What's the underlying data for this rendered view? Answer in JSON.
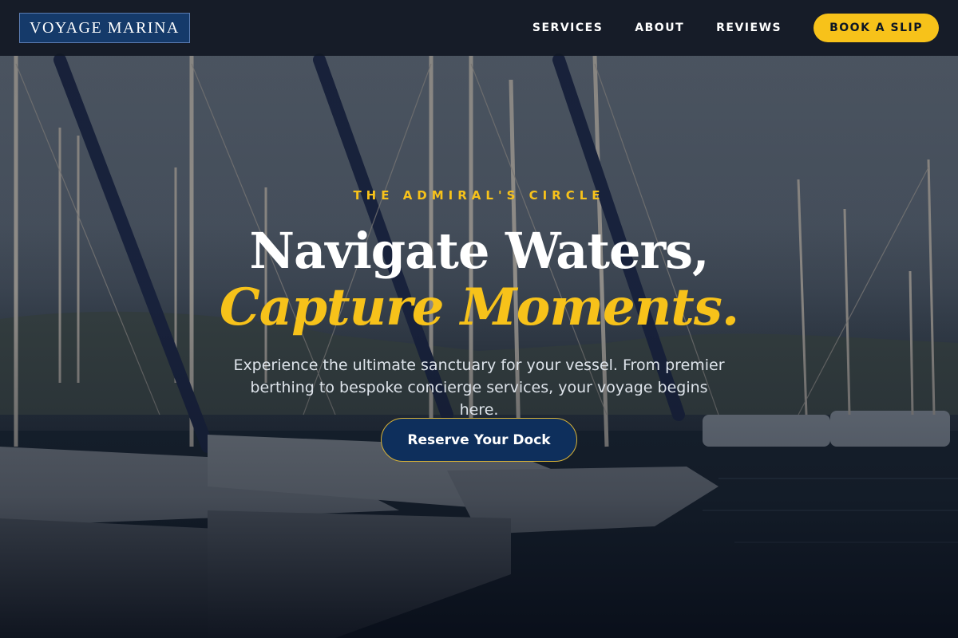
{
  "brand": {
    "logo_text": "VOYAGE MARINA"
  },
  "nav": {
    "items": [
      {
        "label": "SERVICES"
      },
      {
        "label": "ABOUT"
      },
      {
        "label": "REVIEWS"
      }
    ],
    "cta_label": "BOOK A SLIP"
  },
  "hero": {
    "eyebrow": "THE ADMIRAL'S CIRCLE",
    "headline_line1": "Navigate Waters,",
    "headline_line2": "Capture Moments.",
    "subtext": "Experience the ultimate sanctuary for your vessel. From premier berthing to bespoke concierge services, your voyage begins here.",
    "cta_label": "Reserve Your Dock",
    "background_description_icon": "marina-photo"
  },
  "colors": {
    "accent": "#f7c21a",
    "navy": "#0e2f5c",
    "nav_bg": "#111824"
  }
}
